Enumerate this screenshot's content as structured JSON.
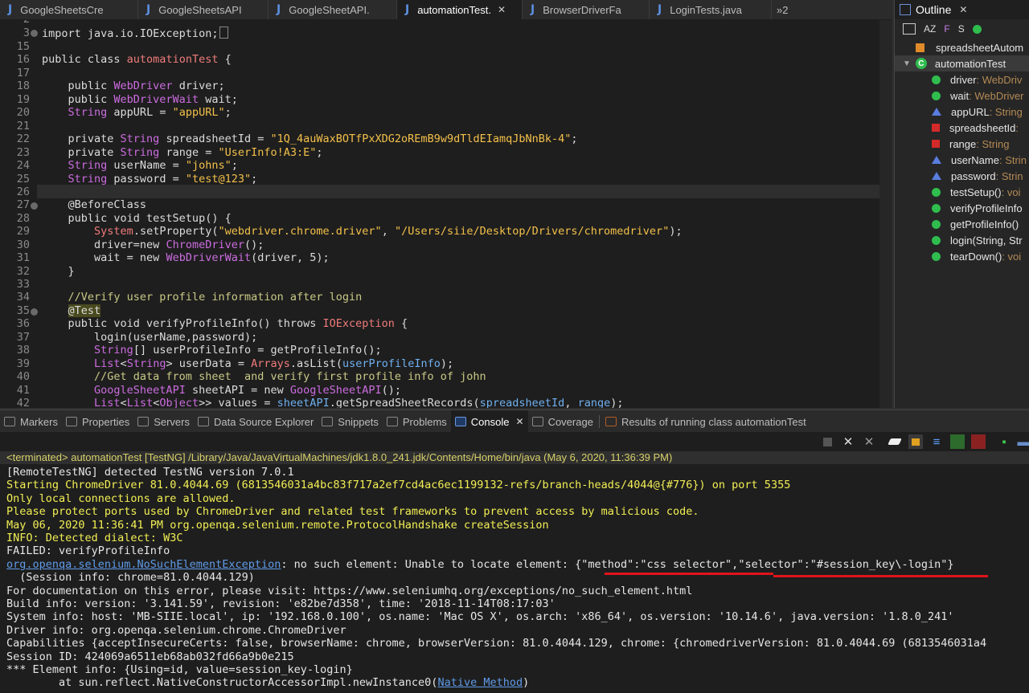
{
  "editor_tabs": [
    {
      "label": "GoogleSheetsCre",
      "active": false
    },
    {
      "label": "GoogleSheetsAPI",
      "active": false
    },
    {
      "label": "GoogleSheetAPI.",
      "active": false
    },
    {
      "label": "automationTest.",
      "active": true
    },
    {
      "label": "BrowserDriverFa",
      "active": false
    },
    {
      "label": "LoginTests.java",
      "active": false
    }
  ],
  "editor_tab_overflow": "»2",
  "tab_icon_glyph": "J",
  "close_glyph": "✕",
  "line_numbers": [
    "2",
    "3",
    "15",
    "16",
    "17",
    "18",
    "19",
    "20",
    "21",
    "22",
    "23",
    "24",
    "25",
    "26",
    "27",
    "28",
    "29",
    "30",
    "31",
    "32",
    "33",
    "34",
    "35",
    "36",
    "37",
    "38",
    "39",
    "40",
    "41",
    "42"
  ],
  "code": {
    "l2": "",
    "l3": "import java.io.IOException;",
    "l16a": "public class ",
    "l16b": "automationTest",
    "l16c": " {",
    "l18a": "    public ",
    "l18b": "WebDriver",
    "l18c": " driver;",
    "l19a": "    public ",
    "l19b": "WebDriverWait",
    "l19c": " wait;",
    "l20a": "    ",
    "l20b": "String",
    "l20c": " appURL = ",
    "l20d": "\"appURL\"",
    "l20e": ";",
    "l22a": "    private ",
    "l22b": "String",
    "l22c": " spreadsheetId = ",
    "l22d": "\"1Q_4auWaxBOTfPxXDG2oREmB9w9dTldEIamqJbNnBk-4\"",
    "l22e": ";",
    "l23a": "    private ",
    "l23b": "String",
    "l23c": " range = ",
    "l23d": "\"UserInfo!A3:E\"",
    "l23e": ";",
    "l24a": "    ",
    "l24b": "String",
    "l24c": " userName = ",
    "l24d": "\"johns\"",
    "l24e": ";",
    "l25a": "    ",
    "l25b": "String",
    "l25c": " password = ",
    "l25d": "\"test@123\"",
    "l25e": ";",
    "l27": "    @BeforeClass",
    "l28": "    public void testSetup() {",
    "l29a": "        ",
    "l29b": "System",
    "l29c": ".setProperty(",
    "l29d": "\"webdriver.chrome.driver\"",
    "l29e": ", ",
    "l29f": "\"/Users/siie/Desktop/Drivers/chromedriver\"",
    "l29g": ");",
    "l30a": "        driver=new ",
    "l30b": "ChromeDriver",
    "l30c": "();",
    "l31a": "        wait = new ",
    "l31b": "WebDriverWait",
    "l31c": "(driver, 5);",
    "l32": "    }",
    "l34": "    //Verify user profile information after login",
    "l35a": "    ",
    "l35b": "@Test",
    "l36a": "    public void verifyProfileInfo() throws ",
    "l36b": "IOException",
    "l36c": " {",
    "l37": "        login(userName,password);",
    "l38a": "        ",
    "l38b": "String",
    "l38c": "[] userProfileInfo = getProfileInfo();",
    "l39a": "        ",
    "l39b": "List",
    "l39c": "<",
    "l39d": "String",
    "l39e": "> userData = ",
    "l39f": "Arrays",
    "l39g": ".asList(",
    "l39h": "userProfileInfo",
    "l39i": ");",
    "l40": "        //Get data from sheet  and verify first profile info of john",
    "l41a": "        ",
    "l41b": "GoogleSheetAPI",
    "l41c": " sheetAPI = new ",
    "l41d": "GoogleSheetAPI",
    "l41e": "();",
    "l42a": "        ",
    "l42b": "List",
    "l42c": "<",
    "l42d": "List",
    "l42e": "<",
    "l42f": "Object",
    "l42g": ">> values = ",
    "l42h": "sheetAPI",
    "l42i": ".getSpreadSheetRecords(",
    "l42j": "spreadsheetId",
    "l42k": ", ",
    "l42l": "range",
    "l42m": ");"
  },
  "outline": {
    "title": "Outline",
    "toolbar": [
      "AZ",
      "F",
      "S"
    ],
    "items": [
      {
        "name": "spreadsheetAutom",
        "type": "",
        "icon": "package-icon"
      },
      {
        "name": "automationTest",
        "type": "",
        "icon": "class-icon"
      },
      {
        "name": "driver",
        "type": " : WebDriv",
        "icon": "public-field-icon"
      },
      {
        "name": "wait",
        "type": " : WebDriver",
        "icon": "public-field-icon"
      },
      {
        "name": "appURL",
        "type": " : String",
        "icon": "default-field-icon"
      },
      {
        "name": "spreadsheetId",
        "type": " :",
        "icon": "private-field-icon"
      },
      {
        "name": "range",
        "type": " : String",
        "icon": "private-field-icon"
      },
      {
        "name": "userName",
        "type": " : Strin",
        "icon": "default-field-icon"
      },
      {
        "name": "password",
        "type": " : Strin",
        "icon": "default-field-icon"
      },
      {
        "name": "testSetup()",
        "type": " : voi",
        "icon": "public-method-icon"
      },
      {
        "name": "verifyProfileInfo",
        "type": "",
        "icon": "public-method-icon"
      },
      {
        "name": "getProfileInfo()",
        "type": "",
        "icon": "public-method-icon"
      },
      {
        "name": "login(String, Str",
        "type": "",
        "icon": "public-method-icon"
      },
      {
        "name": "tearDown()",
        "type": " : voi",
        "icon": "public-method-icon"
      }
    ]
  },
  "views": [
    {
      "label": "Markers",
      "active": false
    },
    {
      "label": "Properties",
      "active": false
    },
    {
      "label": "Servers",
      "active": false
    },
    {
      "label": "Data Source Explorer",
      "active": false
    },
    {
      "label": "Snippets",
      "active": false
    },
    {
      "label": "Problems",
      "active": false
    },
    {
      "label": "Console",
      "active": true
    },
    {
      "label": "Coverage",
      "active": false
    },
    {
      "label": "Results of running class automationTest",
      "active": false
    }
  ],
  "console": {
    "terminated": "<terminated> automationTest [TestNG] /Library/Java/JavaVirtualMachines/jdk1.8.0_241.jdk/Contents/Home/bin/java (May 6, 2020, 11:36:39 PM)",
    "l1": "[RemoteTestNG] detected TestNG version 7.0.1",
    "l2": "Starting ChromeDriver 81.0.4044.69 (6813546031a4bc83f717a2ef7cd4ac6ec1199132-refs/branch-heads/4044@{#776}) on port 5355",
    "l3": "Only local connections are allowed.",
    "l4": "Please protect ports used by ChromeDriver and related test frameworks to prevent access by malicious code.",
    "l5": "May 06, 2020 11:36:41 PM org.openqa.selenium.remote.ProtocolHandshake createSession",
    "l6": "INFO: Detected dialect: W3C",
    "l7": "FAILED: verifyProfileInfo",
    "l8a": "org.openqa.selenium.NoSuchElementException",
    "l8b": ": no such element: Unable to locate element: {\"method\":\"css selector\",\"selector\":\"#session_key\\-login\"}",
    "l9": "  (Session info: chrome=81.0.4044.129)",
    "l10": "For documentation on this error, please visit: https://www.seleniumhq.org/exceptions/no_such_element.html",
    "l11": "Build info: version: '3.141.59', revision: 'e82be7d358', time: '2018-11-14T08:17:03'",
    "l12": "System info: host: 'MB-SIIE.local', ip: '192.168.0.100', os.name: 'Mac OS X', os.arch: 'x86_64', os.version: '10.14.6', java.version: '1.8.0_241'",
    "l13": "Driver info: org.openqa.selenium.chrome.ChromeDriver",
    "l14": "Capabilities {acceptInsecureCerts: false, browserName: chrome, browserVersion: 81.0.4044.129, chrome: {chromedriverVersion: 81.0.4044.69 (6813546031a4",
    "l15": "Session ID: 424069a6511eb68ab032fd66a9b0e215",
    "l16": "*** Element info: {Using=id, value=session_key-login}",
    "l17a": "        at sun.reflect.NativeConstructorAccessorImpl.newInstance0(",
    "l17b": "Native Method",
    "l17c": ")"
  },
  "colors": {
    "underline": "#e0141b",
    "stderr": "#f2ef54",
    "link": "#5f9be8"
  }
}
